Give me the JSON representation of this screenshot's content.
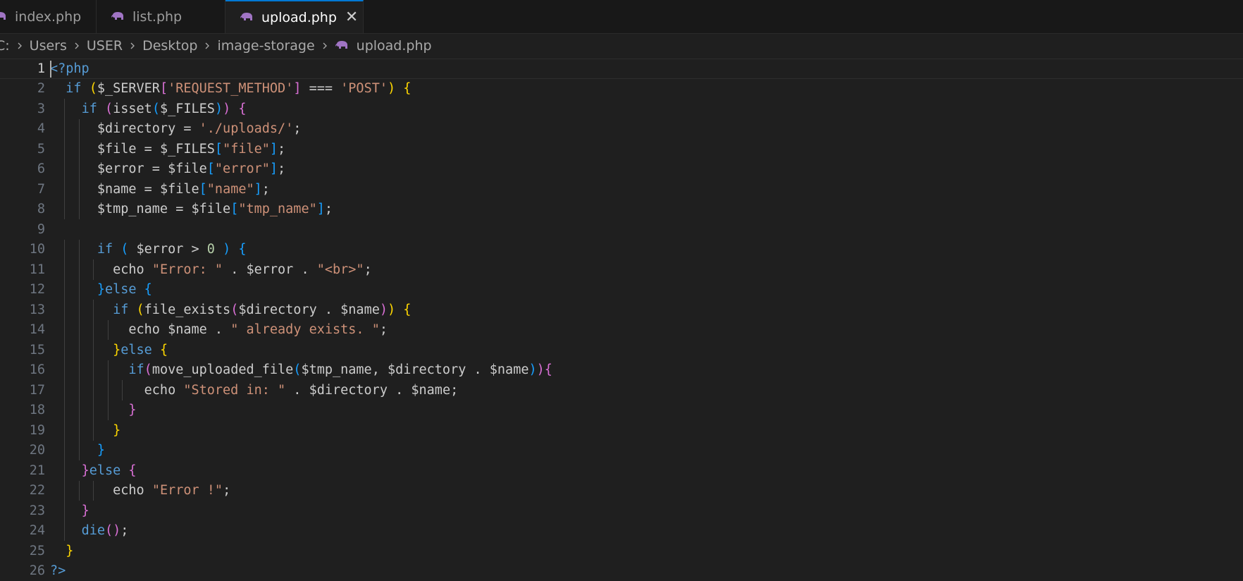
{
  "tabs": [
    {
      "label": "index.php",
      "icon": "php-elephant-icon"
    },
    {
      "label": "list.php",
      "icon": "php-elephant-icon"
    },
    {
      "label": "upload.php",
      "icon": "php-elephant-icon",
      "active": true,
      "close_glyph": "✕"
    }
  ],
  "breadcrumb": [
    "C:",
    "Users",
    "USER",
    "Desktop",
    "image-storage",
    "upload.php"
  ],
  "editor": {
    "current_line": 1,
    "lines": [
      {
        "n": "1",
        "text": "<?php"
      },
      {
        "n": "2",
        "text": "  if ($_SERVER['REQUEST_METHOD'] === 'POST') {"
      },
      {
        "n": "3",
        "text": "    if (isset($_FILES)) {"
      },
      {
        "n": "4",
        "text": "      $directory = './uploads/';"
      },
      {
        "n": "5",
        "text": "      $file = $_FILES[\"file\"];"
      },
      {
        "n": "6",
        "text": "      $error = $file[\"error\"];"
      },
      {
        "n": "7",
        "text": "      $name = $file[\"name\"];"
      },
      {
        "n": "8",
        "text": "      $tmp_name = $file[\"tmp_name\"];"
      },
      {
        "n": "9",
        "text": ""
      },
      {
        "n": "10",
        "text": "      if ( $error > 0 ) {"
      },
      {
        "n": "11",
        "text": "        echo \"Error: \" . $error . \"<br>\";"
      },
      {
        "n": "12",
        "text": "      }else {"
      },
      {
        "n": "13",
        "text": "        if (file_exists($directory . $name)) {"
      },
      {
        "n": "14",
        "text": "          echo $name . \" already exists. \";"
      },
      {
        "n": "15",
        "text": "        }else {"
      },
      {
        "n": "16",
        "text": "          if(move_uploaded_file($tmp_name, $directory . $name)){"
      },
      {
        "n": "17",
        "text": "            echo \"Stored in: \" . $directory . $name;"
      },
      {
        "n": "18",
        "text": "          }"
      },
      {
        "n": "19",
        "text": "        }"
      },
      {
        "n": "20",
        "text": "      }"
      },
      {
        "n": "21",
        "text": "    }else {"
      },
      {
        "n": "22",
        "text": "        echo \"Error !\";"
      },
      {
        "n": "23",
        "text": "    }"
      },
      {
        "n": "24",
        "text": "    die();"
      },
      {
        "n": "25",
        "text": "  }"
      },
      {
        "n": "26",
        "text": "?>"
      }
    ]
  },
  "colors": {
    "background": "#1f1f1f",
    "keyword": "#569cd6",
    "control_keyword": "#c586c0",
    "string": "#ce9178",
    "number": "#b5cea8",
    "bracket_level1": "#ffd700",
    "bracket_level2": "#da70d6",
    "bracket_level3": "#179fff",
    "php_icon": "#a074c4"
  }
}
